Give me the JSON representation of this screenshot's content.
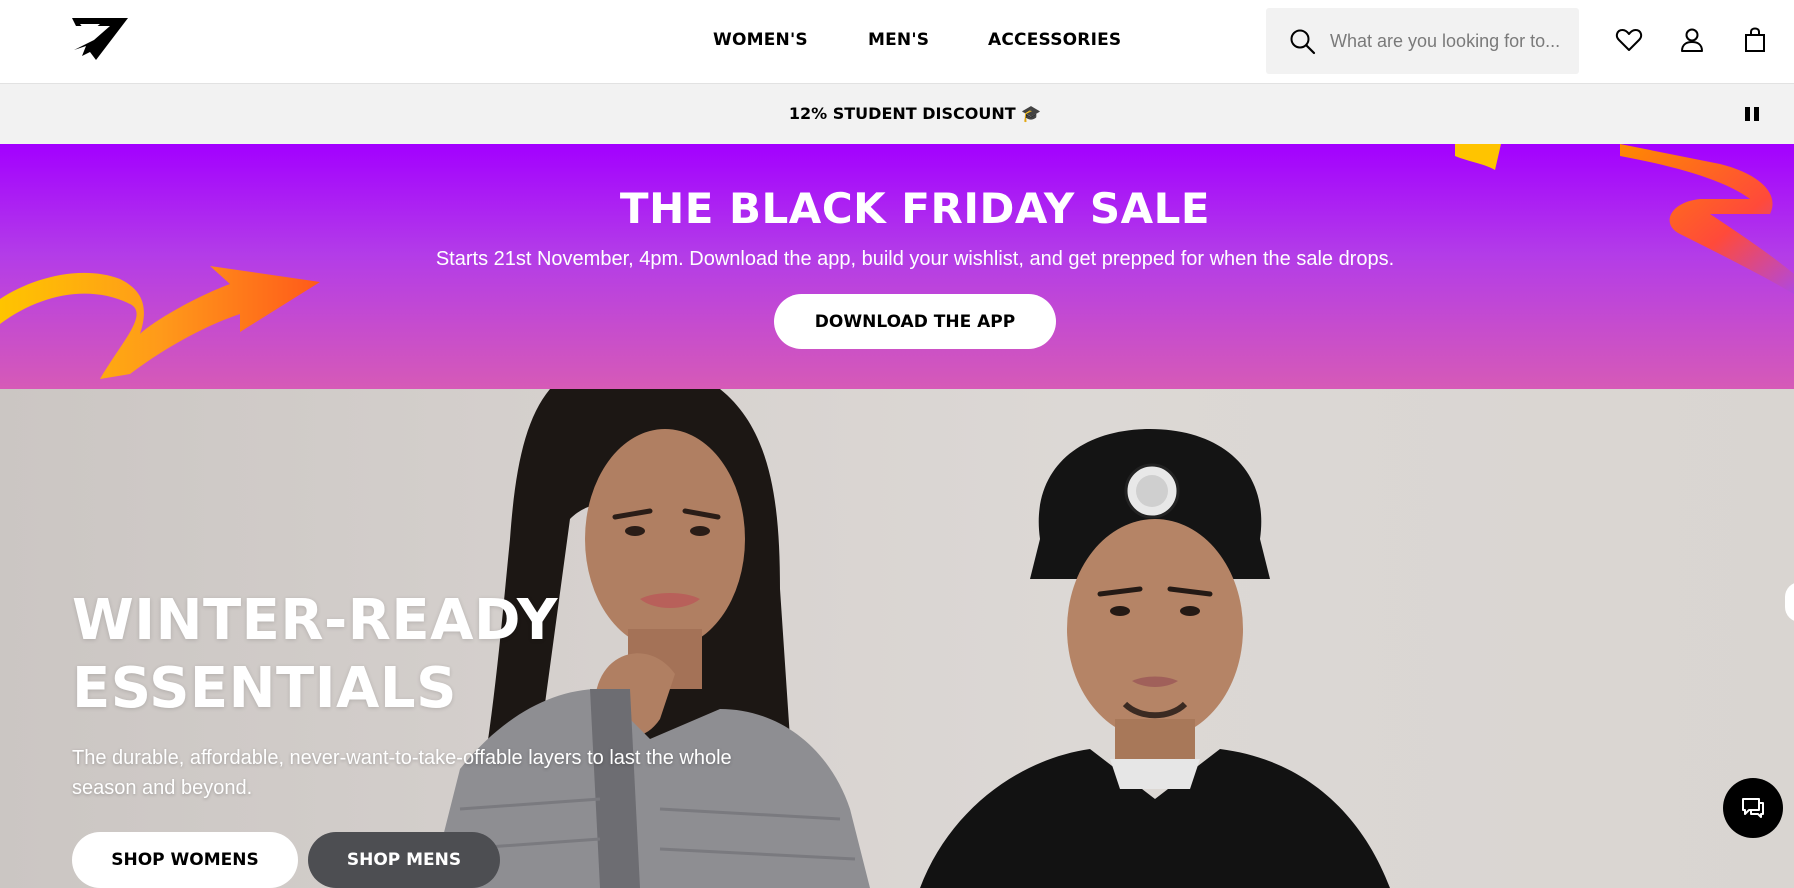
{
  "header": {
    "logo_name": "gymshark-logo",
    "nav": [
      "WOMEN'S",
      "MEN'S",
      "ACCESSORIES"
    ],
    "search_placeholder": "What are you looking for to..."
  },
  "promo_bar": {
    "text": "12% STUDENT DISCOUNT 🎓"
  },
  "sale_banner": {
    "title": "THE BLACK FRIDAY SALE",
    "subtitle": "Starts 21st November, 4pm. Download the app, build your wishlist, and get prepped for when the sale drops.",
    "button": "DOWNLOAD THE APP",
    "colors": {
      "top": "#a300ff",
      "bottom": "#d65ab7",
      "arrow_orange": "#ff6a1a",
      "arrow_yellow": "#ffc400"
    }
  },
  "hero": {
    "title_line1": "WINTER-READY",
    "title_line2": "ESSENTIALS",
    "description": "The durable, affordable, never-want-to-take-offable layers to last the whole season and beyond.",
    "button_women": "SHOP WOMENS",
    "button_men": "SHOP MENS"
  },
  "icons": [
    "search-icon",
    "heart-icon",
    "account-icon",
    "bag-icon",
    "pause-icon",
    "chat-icon"
  ]
}
